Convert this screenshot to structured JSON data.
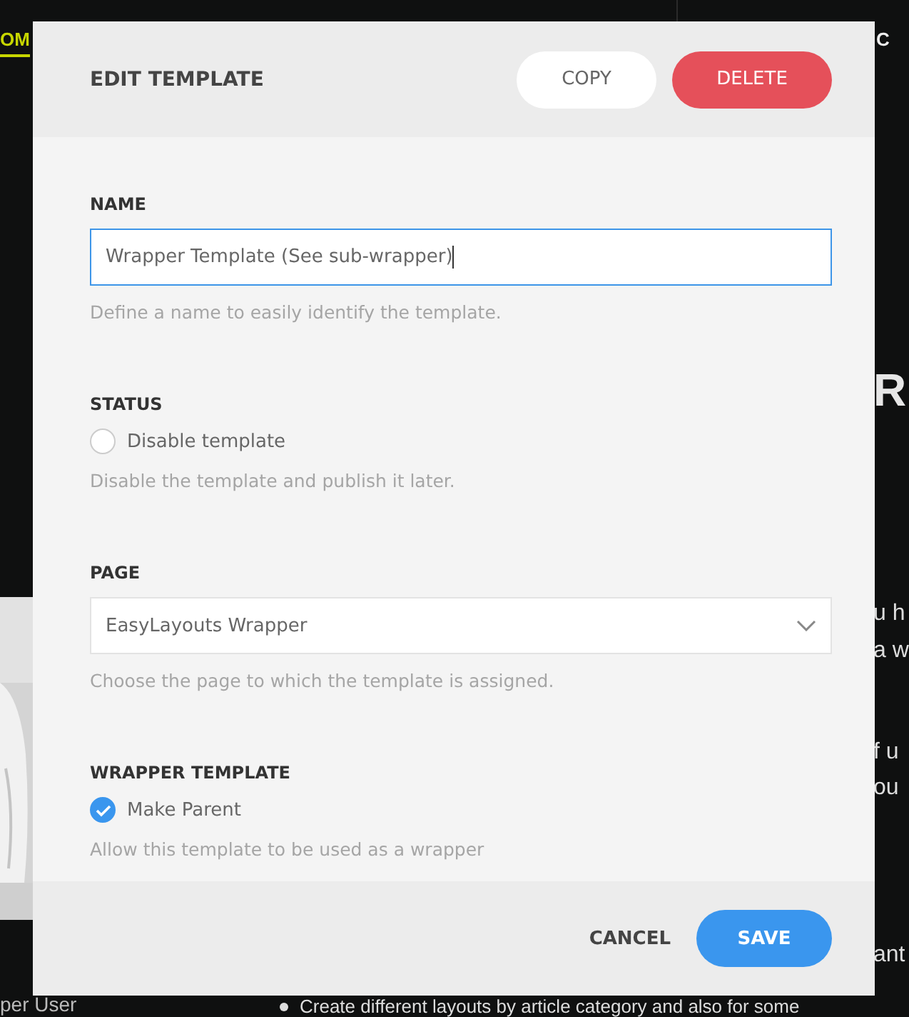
{
  "backdrop": {
    "nav_items": [
      {
        "label": "OM",
        "selected": true
      },
      {
        "label": "C",
        "selected": false
      }
    ],
    "hero_right": [
      "R"
    ],
    "body_right": [
      "u h",
      "a w",
      "f u",
      "ou",
      "ant"
    ],
    "photo": {
      "kind": "picture"
    },
    "caption": "per User",
    "bullet": "Create different layouts by article category and also for some"
  },
  "dialog": {
    "title": "EDIT TEMPLATE",
    "header_buttons": [
      {
        "label": "COPY",
        "kind": "secondary"
      },
      {
        "label": "DELETE",
        "kind": "danger"
      }
    ],
    "fields": [
      {
        "kind": "text",
        "label": "NAME",
        "value": "Wrapper Template (See sub-wrapper)",
        "focused": true,
        "help": "Define a name to easily identify the template."
      },
      {
        "kind": "radio",
        "label": "STATUS",
        "option": "Disable template",
        "checked": false,
        "help": "Disable the template and publish it later."
      },
      {
        "kind": "select",
        "label": "PAGE",
        "value": "EasyLayouts Wrapper",
        "help": "Choose the page to which the template is assigned."
      },
      {
        "kind": "checkbox",
        "label": "WRAPPER TEMPLATE",
        "option": "Make Parent",
        "checked": true,
        "help": "Allow this template to be used as a wrapper"
      }
    ],
    "footer_buttons": [
      {
        "label": "CANCEL",
        "kind": "link"
      },
      {
        "label": "SAVE",
        "kind": "primary"
      }
    ]
  }
}
